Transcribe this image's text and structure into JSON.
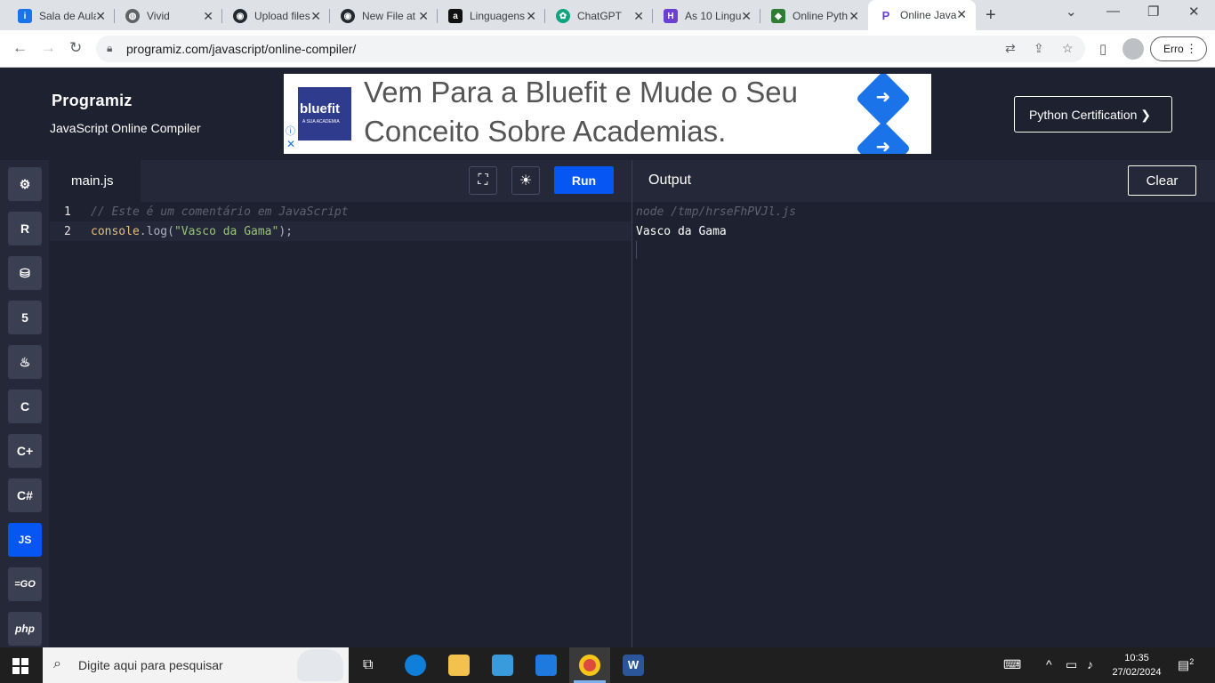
{
  "browser": {
    "tabs": [
      {
        "label": "Sala de Aula",
        "icon": "info-icon",
        "color": "#1a73e8"
      },
      {
        "label": "Vivid",
        "icon": "globe-icon",
        "color": "#5f6368"
      },
      {
        "label": "Upload files",
        "icon": "github-icon",
        "color": "#24292f"
      },
      {
        "label": "New File at",
        "icon": "github-icon",
        "color": "#24292f"
      },
      {
        "label": "Linguagens",
        "icon": "app-icon",
        "color": "#111111"
      },
      {
        "label": "ChatGPT",
        "icon": "chatgpt-icon",
        "color": "#10a37f"
      },
      {
        "label": "As 10 Lingu",
        "icon": "hashtag-icon",
        "color": "#6b3fd4"
      },
      {
        "label": "Online Pyth",
        "icon": "shield-icon",
        "color": "#2e7d32"
      },
      {
        "label": "Online Java",
        "icon": "programiz-icon",
        "color": "#6b3fd4",
        "active": true
      }
    ],
    "url": "programiz.com/javascript/online-compiler/",
    "profile_label": "Erro"
  },
  "header": {
    "logo": "Programiz",
    "subtitle": "JavaScript Online Compiler",
    "ad": {
      "brand": "bluefit",
      "brand_sub": "A SUA ACADEMIA",
      "line1": "Vem Para a Bluefit e Mude o Seu",
      "line2": "Conceito Sobre Academias."
    },
    "cert_button": "Python Certification ❯"
  },
  "sidebar": {
    "languages": [
      {
        "name": "python",
        "glyph": "⚙"
      },
      {
        "name": "r",
        "glyph": "R"
      },
      {
        "name": "sql",
        "glyph": "⛁"
      },
      {
        "name": "html",
        "glyph": "5"
      },
      {
        "name": "java",
        "glyph": "♨"
      },
      {
        "name": "c",
        "glyph": "C"
      },
      {
        "name": "cpp",
        "glyph": "C+"
      },
      {
        "name": "csharp",
        "glyph": "C#"
      },
      {
        "name": "javascript",
        "glyph": "JS",
        "active": true
      },
      {
        "name": "go",
        "glyph": "=GO"
      },
      {
        "name": "php",
        "glyph": "php"
      }
    ]
  },
  "editor": {
    "filename": "main.js",
    "run_label": "Run",
    "lines": [
      {
        "num": "1",
        "comment": "// Este é um comentário em JavaScript"
      },
      {
        "num": "2",
        "ident": "console",
        "plain1": ".log(",
        "str": "\"Vasco da Gama\"",
        "plain2": ");"
      }
    ]
  },
  "output": {
    "title": "Output",
    "clear_label": "Clear",
    "command": "node /tmp/hrseFhPVJl.js",
    "result": "Vasco da Gama"
  },
  "taskbar": {
    "search_placeholder": "Digite aqui para pesquisar",
    "time": "10:35",
    "date": "27/02/2024",
    "notification_count": "2"
  }
}
